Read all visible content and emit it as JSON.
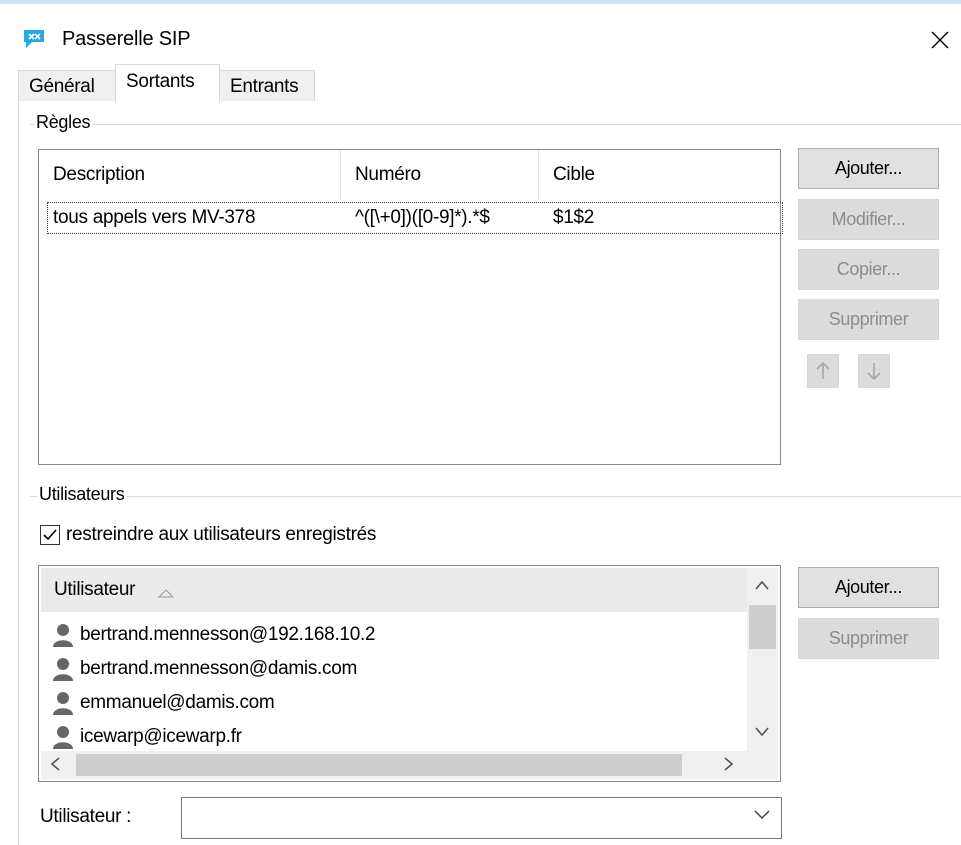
{
  "window": {
    "title": "Passerelle SIP",
    "app_icon": "sip-bubble-icon",
    "close_icon": "close-icon"
  },
  "tabs": [
    {
      "label": "Général",
      "active": false
    },
    {
      "label": "Sortants",
      "active": true
    },
    {
      "label": "Entrants",
      "active": false
    }
  ],
  "rules": {
    "group_label": "Règles",
    "columns": [
      "Description",
      "Numéro",
      "Cible"
    ],
    "rows": [
      {
        "description": "tous appels vers MV-378",
        "numero": "^([\\+0])([0-9]*).*$",
        "cible": "$1$2",
        "selected": true
      }
    ],
    "buttons": {
      "add": "Ajouter...",
      "modify": "Modifier...",
      "copy": "Copier...",
      "delete": "Supprimer"
    },
    "move_up_icon": "arrow-up-icon",
    "move_down_icon": "arrow-down-icon"
  },
  "users": {
    "group_label": "Utilisateurs",
    "restrict_label": "restreindre aux utilisateurs enregistrés",
    "restrict_checked": true,
    "column": "Utilisateur",
    "sort_icon": "sort-indicator-icon",
    "rows": [
      "bertrand.mennesson@192.168.10.2",
      "bertrand.mennesson@damis.com",
      "emmanuel@damis.com",
      "icewarp@icewarp.fr"
    ],
    "user_icon": "user-icon",
    "buttons": {
      "add": "Ajouter...",
      "delete": "Supprimer"
    },
    "field_label": "Utilisateur :",
    "field_value": ""
  },
  "colors": {
    "window_border": "#cfe3f7",
    "button_face": "#e1e1e1",
    "disabled_text": "#8c8c8c"
  }
}
